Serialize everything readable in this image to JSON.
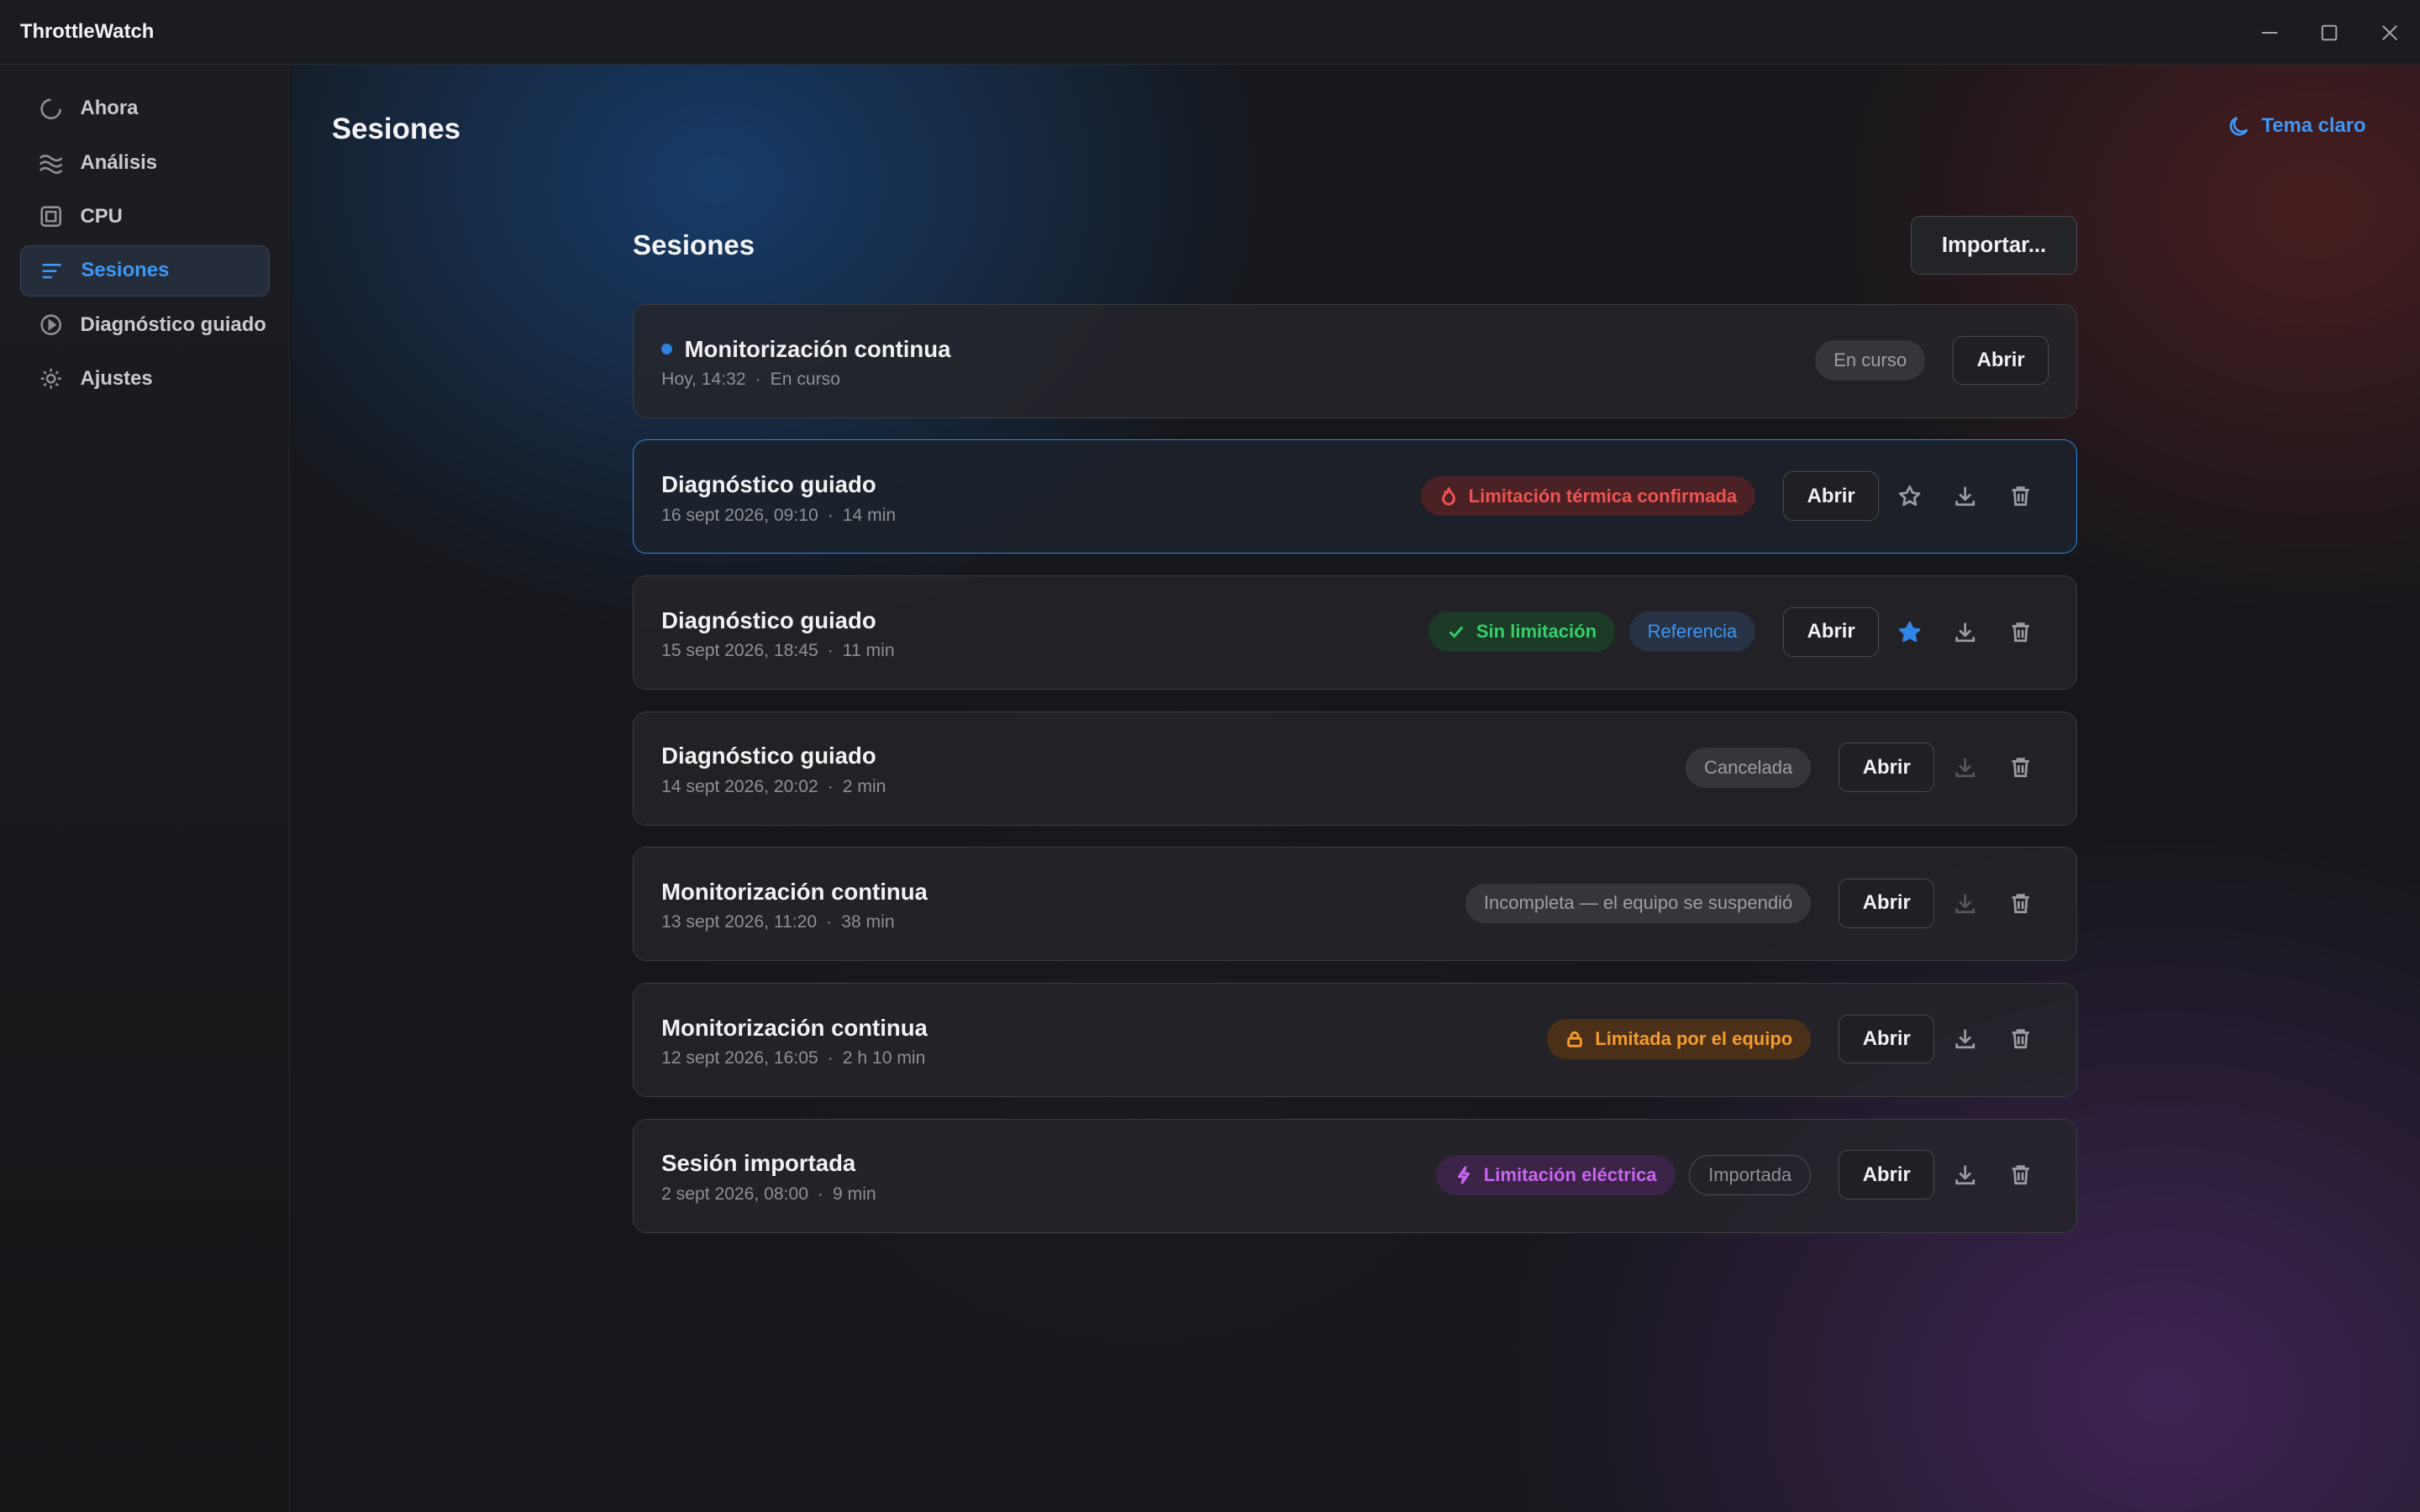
{
  "app": {
    "title": "ThrottleWatch"
  },
  "sidebar": {
    "items": [
      {
        "label": "Ahora",
        "icon": "spinner-icon",
        "active": false
      },
      {
        "label": "Análisis",
        "icon": "waves-icon",
        "active": false
      },
      {
        "label": "CPU",
        "icon": "chip-icon",
        "active": false
      },
      {
        "label": "Sesiones",
        "icon": "list-icon",
        "active": true
      },
      {
        "label": "Diagnóstico guiado",
        "icon": "play-circle-icon",
        "active": false
      },
      {
        "label": "Ajustes",
        "icon": "gear-icon",
        "active": false
      }
    ]
  },
  "header": {
    "title": "Sesiones",
    "theme_toggle": "Tema claro"
  },
  "sessions_section": {
    "title": "Sesiones",
    "import_label": "Importar..."
  },
  "open_label": "Abrir",
  "sessions": [
    {
      "title": "Monitorización continua",
      "date": "Hoy, 14:32",
      "duration": "En curso",
      "live": true,
      "badges": [
        {
          "text": "En curso",
          "style": "gray"
        }
      ],
      "actions": []
    },
    {
      "title": "Diagnóstico guiado",
      "date": "16 sept 2026, 09:10",
      "duration": "14 min",
      "selected": true,
      "badges": [
        {
          "text": "Limitación térmica confirmada",
          "style": "red",
          "icon": "flame-icon"
        }
      ],
      "actions": [
        "star",
        "download",
        "delete"
      ]
    },
    {
      "title": "Diagnóstico guiado",
      "date": "15 sept 2026, 18:45",
      "duration": "11 min",
      "badges": [
        {
          "text": "Sin limitación",
          "style": "green",
          "icon": "check-icon"
        },
        {
          "text": "Referencia",
          "style": "blue"
        }
      ],
      "actions": [
        "star-filled",
        "download",
        "delete"
      ]
    },
    {
      "title": "Diagnóstico guiado",
      "date": "14 sept 2026, 20:02",
      "duration": "2 min",
      "badges": [
        {
          "text": "Cancelada",
          "style": "gray"
        }
      ],
      "actions": [
        "download-disabled",
        "delete"
      ]
    },
    {
      "title": "Monitorización continua",
      "date": "13 sept 2026, 11:20",
      "duration": "38 min",
      "badges": [
        {
          "text": "Incompleta — el equipo se suspendió",
          "style": "gray"
        }
      ],
      "actions": [
        "download-disabled",
        "delete"
      ]
    },
    {
      "title": "Monitorización continua",
      "date": "12 sept 2026, 16:05",
      "duration": "2 h 10 min",
      "badges": [
        {
          "text": "Limitada por el equipo",
          "style": "orange",
          "icon": "lock-icon"
        }
      ],
      "actions": [
        "download",
        "delete"
      ]
    },
    {
      "title": "Sesión importada",
      "date": "2 sept 2026, 08:00",
      "duration": "9 min",
      "badges": [
        {
          "text": "Limitación eléctrica",
          "style": "purple",
          "icon": "bolt-icon"
        },
        {
          "text": "Importada",
          "style": "outline"
        }
      ],
      "actions": [
        "download",
        "delete"
      ]
    }
  ],
  "colors": {
    "accent": "#3d97f4",
    "danger": "#f0524f",
    "success": "#33d06a",
    "warning": "#f59b2a",
    "electric": "#c964ef"
  }
}
